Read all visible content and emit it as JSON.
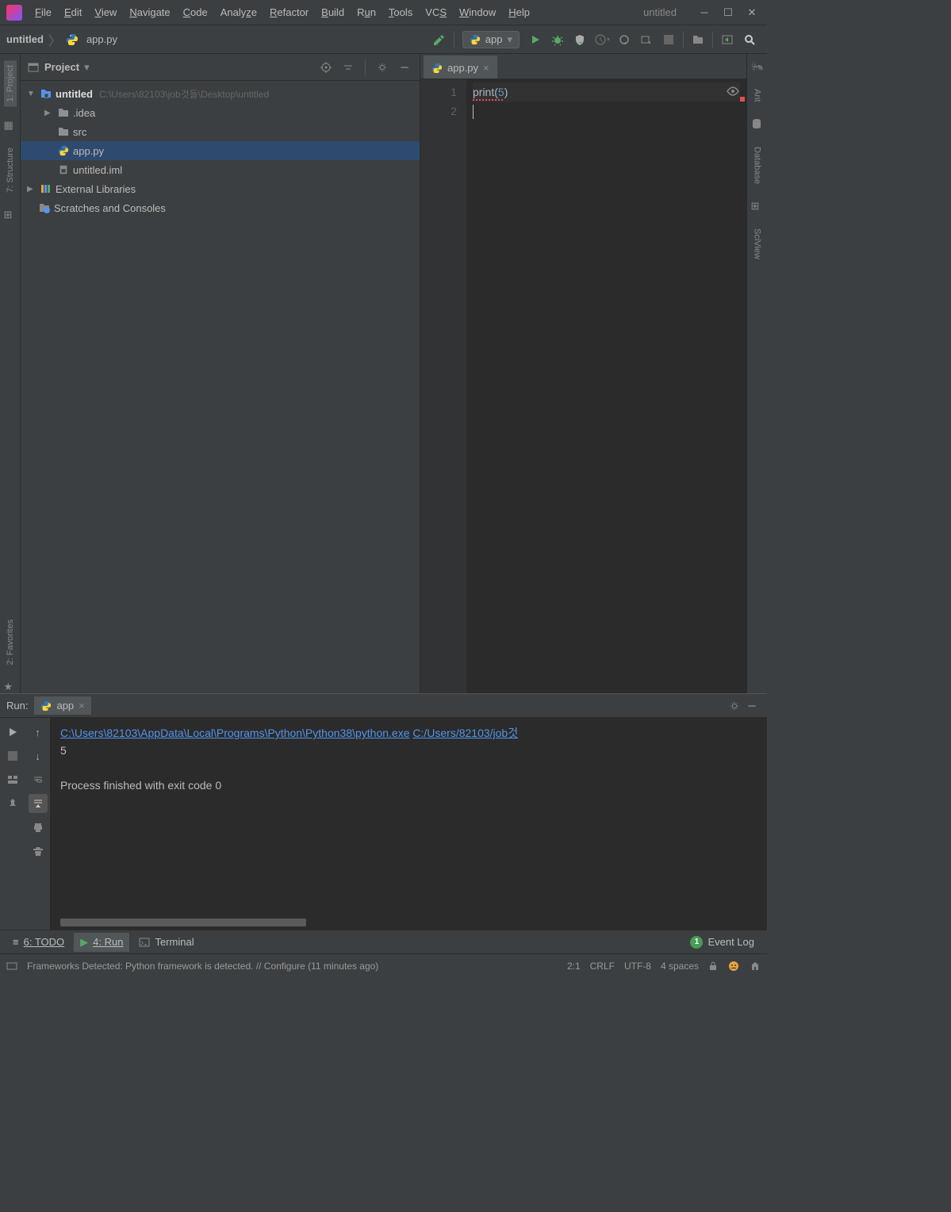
{
  "window": {
    "title": "untitled"
  },
  "menu": [
    "File",
    "Edit",
    "View",
    "Navigate",
    "Code",
    "Analyze",
    "Refactor",
    "Build",
    "Run",
    "Tools",
    "VCS",
    "Window",
    "Help"
  ],
  "breadcrumb": {
    "project": "untitled",
    "file": "app.py"
  },
  "runConfig": {
    "name": "app"
  },
  "projectPanel": {
    "title": "Project",
    "root": {
      "name": "untitled",
      "path": "C:\\Users\\82103\\job것들\\Desktop\\untitled"
    },
    "idea": ".idea",
    "src": "src",
    "app": "app.py",
    "iml": "untitled.iml",
    "ext": "External Libraries",
    "scratches": "Scratches and Consoles"
  },
  "editor": {
    "tab": "app.py",
    "line1_fn": "print",
    "line1_open": "(",
    "line1_arg": "5",
    "line1_close": ")",
    "lineNums": [
      "1",
      "2"
    ]
  },
  "runPanel": {
    "label": "Run:",
    "tab": "app",
    "path1": "C:\\Users\\82103\\AppData\\Local\\Programs\\Python\\Python38\\python.exe",
    "path2": "C:/Users/82103/job것",
    "output": "5",
    "exit": "Process finished with exit code 0"
  },
  "bottomTabs": {
    "todo": "6: TODO",
    "run": "4: Run",
    "terminal": "Terminal",
    "eventlog": "Event Log"
  },
  "status": {
    "msg": "Frameworks Detected: Python framework is detected. // Configure (11 minutes ago)",
    "pos": "2:1",
    "eol": "CRLF",
    "enc": "UTF-8",
    "indent": "4 spaces"
  },
  "leftGutter": [
    "1: Project",
    "7: Structure"
  ],
  "rightGutter": [
    "Ant",
    "Database",
    "SciView"
  ],
  "favGutter": "2: Favorites"
}
